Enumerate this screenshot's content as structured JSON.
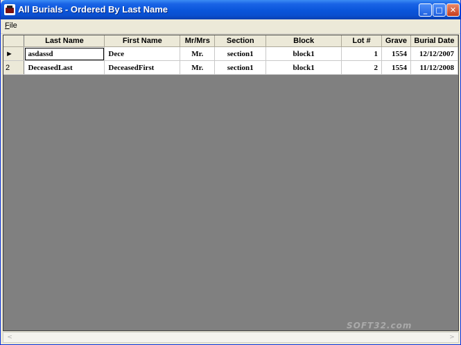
{
  "window": {
    "title": "All Burials - Ordered By Last Name",
    "min_glyph": "_",
    "max_glyph": "□",
    "close_glyph": "✕"
  },
  "menu": {
    "file_mnemonic": "F",
    "file_rest": "ile"
  },
  "grid": {
    "columns": [
      "Last Name",
      "First Name",
      "Mr/Mrs",
      "Section",
      "Block",
      "Lot #",
      "Grave",
      "Burial Date"
    ],
    "rows": [
      {
        "header": "►",
        "last": "asdassd",
        "first": "Dece",
        "title": "Mr.",
        "section": "section1",
        "block": "block1",
        "lot": "1",
        "grave": "1554",
        "date": "12/12/2007"
      },
      {
        "header": "2",
        "last": "DeceasedLast",
        "first": "DeceasedFirst",
        "title": "Mr.",
        "section": "section1",
        "block": "block1",
        "lot": "2",
        "grave": "1554",
        "date": "11/12/2008"
      }
    ]
  },
  "scrollbar": {
    "left_arrow": "<",
    "right_arrow": ">"
  },
  "watermark": "SOFT32.com"
}
